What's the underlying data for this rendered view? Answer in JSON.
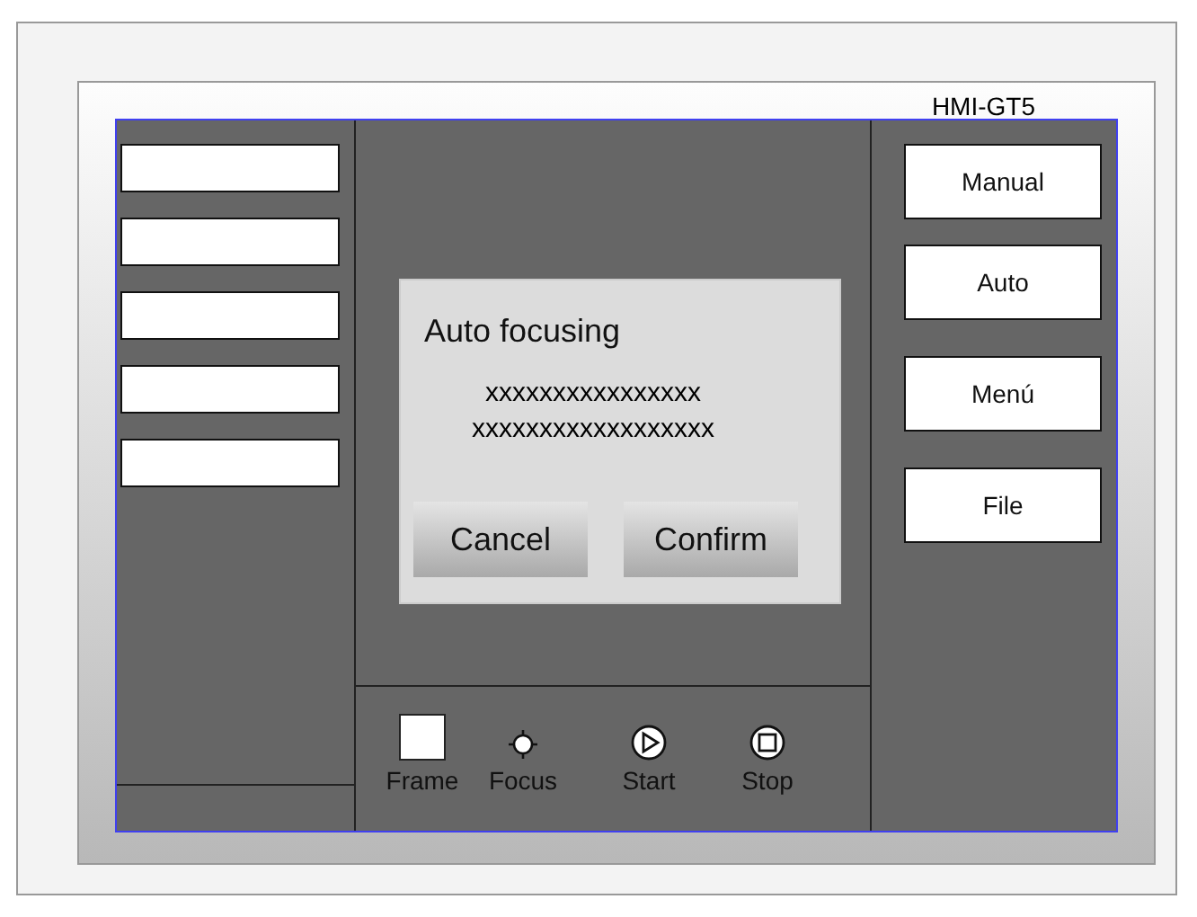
{
  "device": {
    "title": "HMI-GT5"
  },
  "left_fields": [
    {
      "kind": "text"
    },
    {
      "kind": "text"
    },
    {
      "kind": "text"
    },
    {
      "kind": "text"
    },
    {
      "kind": "text"
    }
  ],
  "dialog": {
    "title": "Auto focusing",
    "lines": [
      "xxxxxxxxxxxxxxxx",
      "xxxxxxxxxxxxxxxxxx"
    ],
    "buttons": [
      "Cancel",
      "Confirm"
    ]
  },
  "toolbar": [
    {
      "kind": "frame",
      "label": "Frame"
    },
    {
      "kind": "focus",
      "label": "Focus"
    },
    {
      "kind": "start",
      "label": "Start"
    },
    {
      "kind": "stop",
      "label": "Stop"
    }
  ],
  "side_buttons": [
    "Manual",
    "Auto",
    "Menú",
    "File"
  ]
}
